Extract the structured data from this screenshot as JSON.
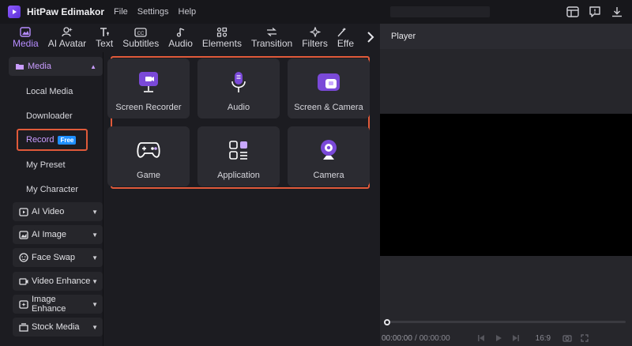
{
  "app": {
    "title": "HitPaw Edimakor"
  },
  "menu": [
    "File",
    "Settings",
    "Help"
  ],
  "tabs": [
    {
      "label": "Media",
      "icon": "media-icon"
    },
    {
      "label": "AI Avatar",
      "icon": "ai-avatar-icon"
    },
    {
      "label": "Text",
      "icon": "text-icon"
    },
    {
      "label": "Subtitles",
      "icon": "subtitles-icon"
    },
    {
      "label": "Audio",
      "icon": "audio-note-icon"
    },
    {
      "label": "Elements",
      "icon": "elements-icon"
    },
    {
      "label": "Transition",
      "icon": "transition-icon"
    },
    {
      "label": "Filters",
      "icon": "filters-icon"
    },
    {
      "label": "Effe",
      "icon": "effects-icon"
    }
  ],
  "sidebar": {
    "media_head": "Media",
    "sub_items": [
      "Local Media",
      "Downloader",
      "My Preset",
      "My Character"
    ],
    "record": {
      "label": "Record",
      "badge": "Free"
    },
    "categories": [
      "AI Video",
      "AI Image",
      "Face Swap",
      "Video Enhance",
      "Image Enhance",
      "Stock Media"
    ]
  },
  "cards": [
    {
      "label": "Screen Recorder",
      "icon": "screen-recorder-icon"
    },
    {
      "label": "Audio",
      "icon": "microphone-icon"
    },
    {
      "label": "Screen & Camera",
      "icon": "screen-camera-icon"
    },
    {
      "label": "Game",
      "icon": "gamepad-icon"
    },
    {
      "label": "Application",
      "icon": "application-icon"
    },
    {
      "label": "Camera",
      "icon": "webcam-icon"
    }
  ],
  "player": {
    "title": "Player",
    "time_current": "00:00:00",
    "time_sep": "/",
    "time_total": "00:00:00",
    "ratio": "16:9"
  },
  "colors": {
    "accent": "#b68cff",
    "highlight_border": "#e05a3a",
    "badge": "#1f8fff"
  }
}
